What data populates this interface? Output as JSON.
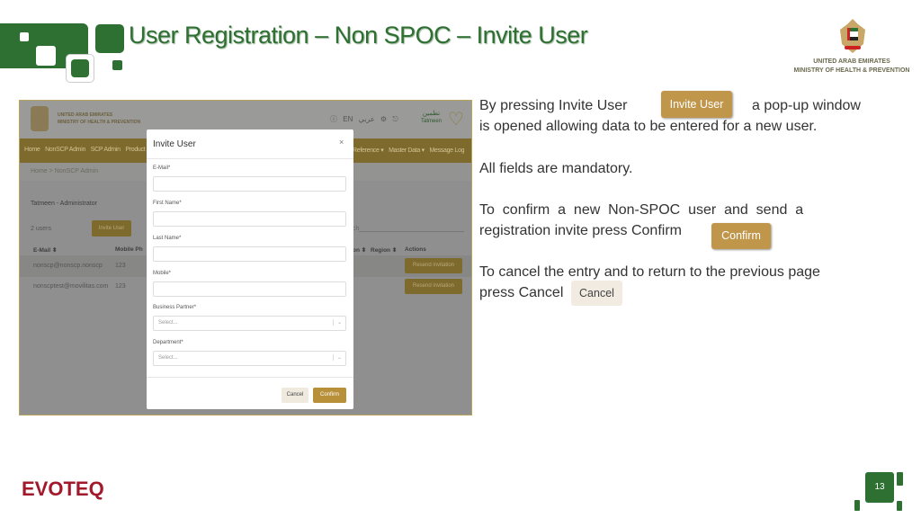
{
  "slide": {
    "title": "User Registration – Non SPOC – Invite User",
    "ministry_line1": "UNITED ARAB EMIRATES",
    "ministry_line2": "MINISTRY OF HEALTH & PREVENTION",
    "footer_logo": "EVOTEQ",
    "page_number": "13",
    "brand_green": "#2e6f32",
    "gold": "#b8903a"
  },
  "app": {
    "ministry_line1": "UNITED ARAB EMIRATES",
    "ministry_line2": "MINISTRY OF HEALTH & PREVENTION",
    "lang_en": "EN",
    "lang_ar": "عربي",
    "brand_ar": "تطمين",
    "brand_en": "Tatmeen",
    "nav": [
      "Home",
      "NonSCP Admin",
      "SCP Admin",
      "Product T",
      "Reference ▾",
      "Master Data ▾",
      "Message Log"
    ],
    "breadcrumb_home": "Home",
    "breadcrumb_sep": ">",
    "breadcrumb_current": "NonSCP Admin",
    "panel_title": "Tatmeen - Administrator",
    "user_count": "2 users",
    "invite_button": "Invite User",
    "search_hint": "ch",
    "columns": [
      "E-Mail ⬍",
      "Mobile Ph",
      "on ⬍",
      "Region ⬍",
      "Actions"
    ],
    "rows": [
      {
        "email": "nonscp@nonscp.nonscp",
        "mobile": "123",
        "action": "Resend invitation"
      },
      {
        "email": "nonscptest@movilitas.com",
        "mobile": "123",
        "action": "Resend invitation"
      }
    ]
  },
  "modal": {
    "title": "Invite User",
    "close": "×",
    "fields": [
      {
        "label": "E-Mail*",
        "value": ""
      },
      {
        "label": "First Name*",
        "value": ""
      },
      {
        "label": "Last Name*",
        "value": ""
      },
      {
        "label": "Mobile*",
        "value": ""
      },
      {
        "label": "Business Partner*",
        "placeholder": "Select..."
      },
      {
        "label": "Department*",
        "placeholder": "Select..."
      }
    ],
    "cancel": "Cancel",
    "confirm": "Confirm"
  },
  "description": {
    "p1_a": "By pressing Invite User",
    "p1_btn": "Invite User",
    "p1_b": "a pop-up window",
    "p1_c": "is opened allowing data  to be entered for a new user.",
    "p2": "All fields are mandatory.",
    "p3_a": "To  confirm  a  new  Non-SPOC  user  and  send  a",
    "p3_b": "registration invite press Confirm",
    "p3_btn": "Confirm",
    "p4_a": "To cancel the entry and to return to the previous page",
    "p4_b": "press Cancel",
    "p4_btn": "Cancel"
  }
}
